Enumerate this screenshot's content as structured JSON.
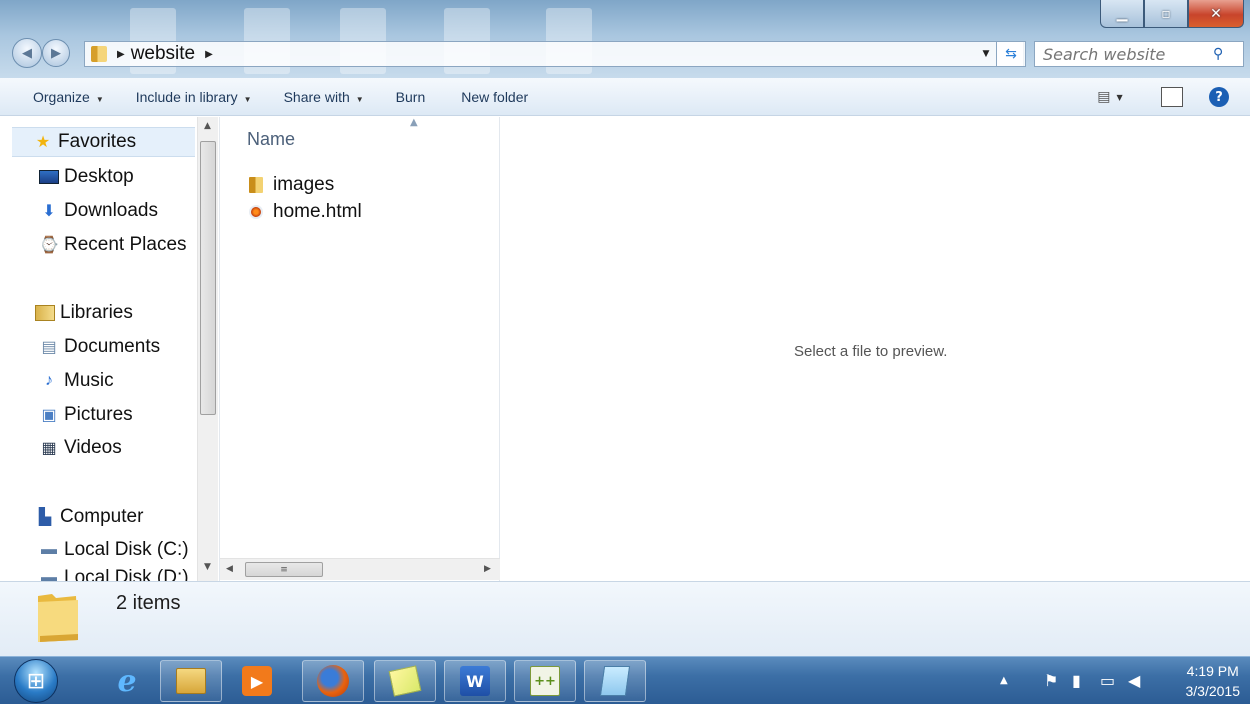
{
  "window": {
    "path_segment": "website",
    "search_placeholder": "Search website"
  },
  "toolbar": {
    "organize": "Organize",
    "include_in_library": "Include in library",
    "share_with": "Share with",
    "burn": "Burn",
    "new_folder": "New folder"
  },
  "nav": {
    "favorites": "Favorites",
    "desktop": "Desktop",
    "downloads": "Downloads",
    "recent_places": "Recent Places",
    "libraries": "Libraries",
    "documents": "Documents",
    "music": "Music",
    "pictures": "Pictures",
    "videos": "Videos",
    "computer": "Computer",
    "local_disk_c": "Local Disk (C:)",
    "local_disk_d": "Local Disk (D:)"
  },
  "content": {
    "column_name": "Name",
    "files": [
      {
        "name": "images",
        "icon": "folder-icon"
      },
      {
        "name": "home.html",
        "icon": "html-file-icon"
      }
    ]
  },
  "preview": {
    "message": "Select a file to preview."
  },
  "details": {
    "item_count": "2 items"
  },
  "taskbar": {
    "time": "4:19 PM",
    "date": "3/3/2015"
  }
}
